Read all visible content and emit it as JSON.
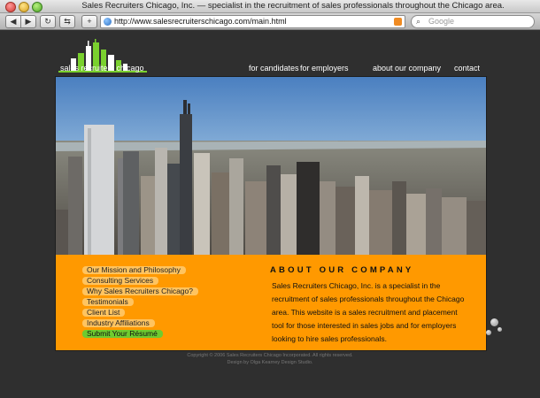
{
  "browser": {
    "window_title": "Sales Recruiters Chicago, Inc. — specialist in the recruitment of sales professionals throughout the Chicago area.",
    "url": "http://www.salesrecruiterschicago.com/main.html",
    "search_placeholder": "Google",
    "back_icon": "◀",
    "forward_icon": "▶",
    "reload_icon": "↻",
    "snapback_icon": "⇆",
    "add_icon": "+",
    "search_icon": "⌕"
  },
  "site": {
    "logo_text": "sales recruiters chicago",
    "nav": [
      "for candidates",
      "for employers",
      "about our company",
      "contact"
    ]
  },
  "sidebar_menu": [
    {
      "label": "Our Mission and Philosophy"
    },
    {
      "label": "Consulting Services"
    },
    {
      "label": "Why Sales Recruiters Chicago?"
    },
    {
      "label": "Testimonials"
    },
    {
      "label": "Client List"
    },
    {
      "label": "Industry Affiliations"
    },
    {
      "label": "Submit Your Résumé",
      "active": true
    }
  ],
  "about": {
    "title": "ABOUT OUR COMPANY",
    "body": "Sales Recruiters Chicago, Inc. is a specialist in the recruitment of sales professionals throughout the Chicago area. This website is a sales recruitment and placement tool for those interested in sales jobs and for employers looking to hire sales professionals."
  },
  "footer": {
    "copyright": "Copyright © 2006 Sales Recruiters Chicago Incorporated. All rights reserved.",
    "credit": "Design by Olga Kearney Design Studio."
  },
  "colors": {
    "panel_orange": "#ff9900",
    "menu_item_bg": "#ffc460",
    "active_item_green": "#6ecb2f",
    "logo_green": "#7ad12e",
    "page_bg": "#2f2f2f"
  }
}
